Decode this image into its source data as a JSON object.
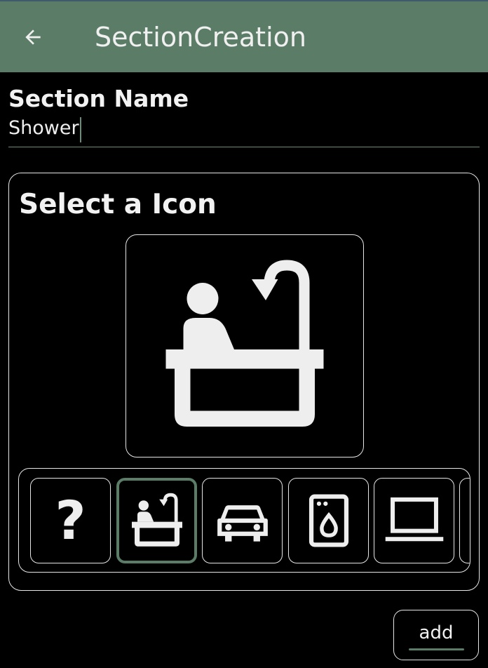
{
  "appbar": {
    "title": "SectionCreation",
    "back_icon": "arrow-back-icon",
    "background": "#5b7c66"
  },
  "section_name": {
    "label": "Section Name",
    "value": "Shower"
  },
  "icon_picker": {
    "title": "Select a Icon",
    "selected_icon": "bathtub-shower-icon",
    "options": [
      {
        "icon": "question-mark-icon",
        "glyph": "?"
      },
      {
        "icon": "bathtub-shower-icon",
        "selected": true
      },
      {
        "icon": "car-icon"
      },
      {
        "icon": "washing-machine-icon"
      },
      {
        "icon": "laptop-icon"
      }
    ]
  },
  "actions": {
    "add_label": "add"
  },
  "colors": {
    "accent": "#5b7c66",
    "foreground": "#eeeeee",
    "background": "#000000"
  }
}
